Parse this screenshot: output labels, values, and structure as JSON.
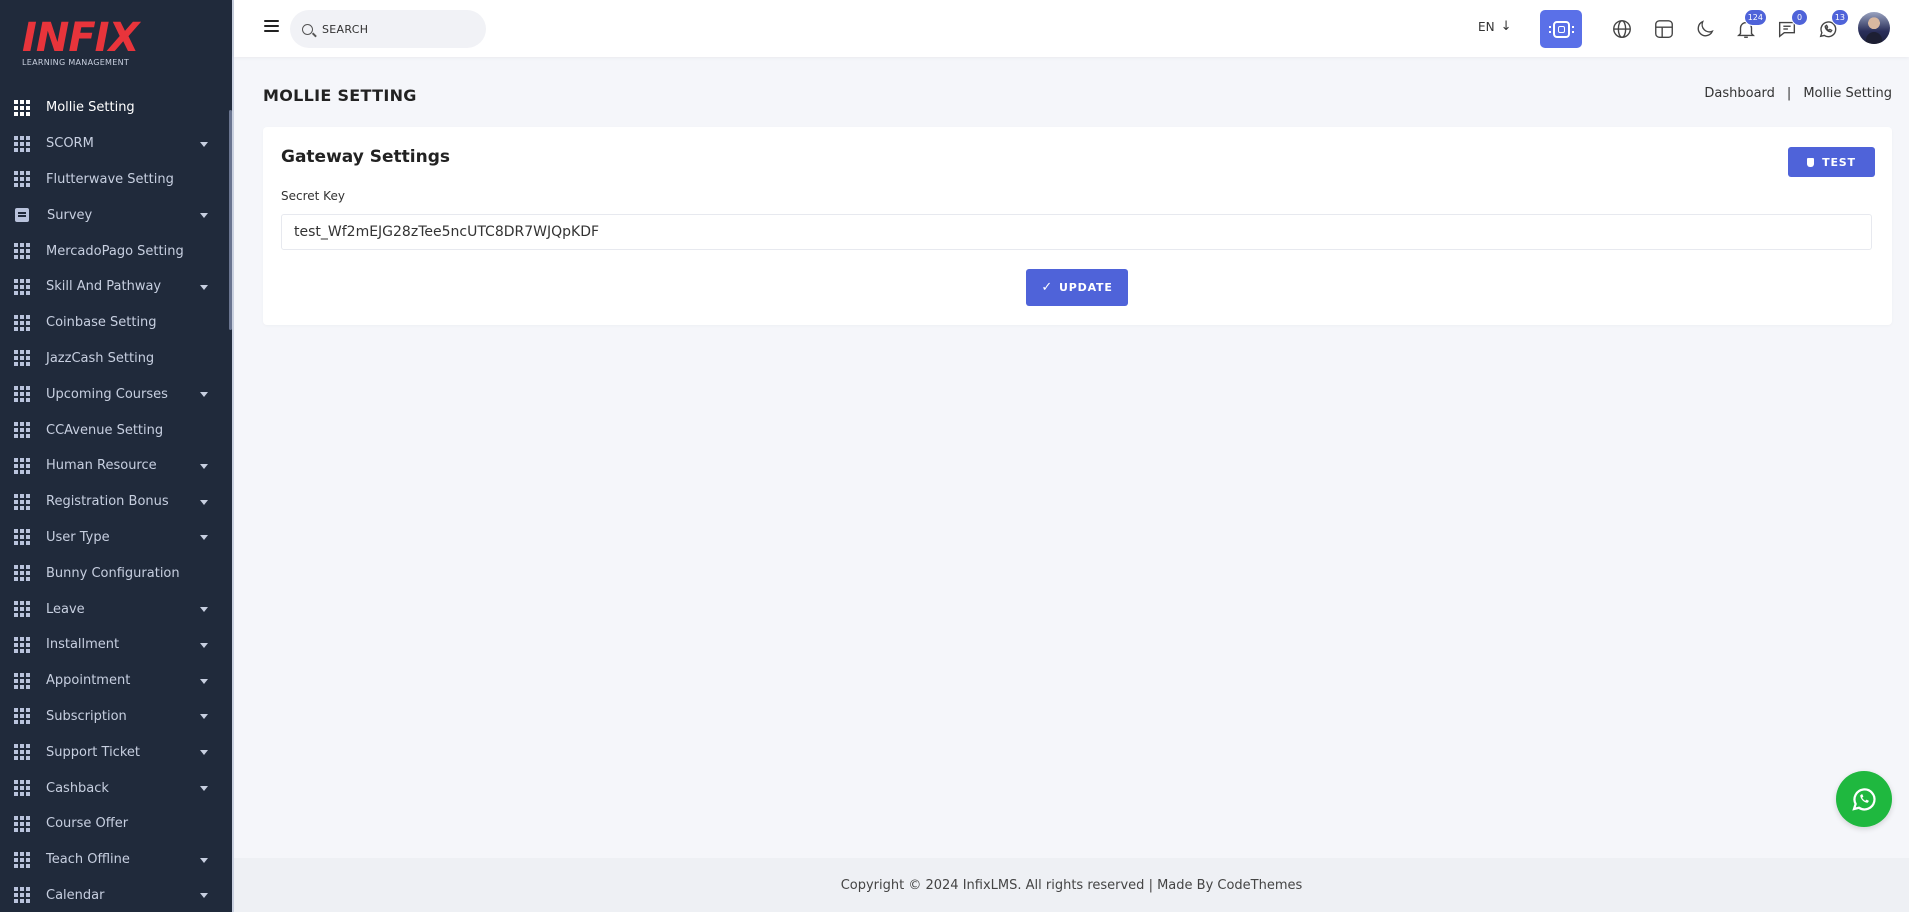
{
  "sidebar": {
    "logo": {
      "brand": "INFIX",
      "tagline": "LEARNING MANAGEMENT"
    },
    "items": [
      {
        "label": "Mollie Setting",
        "icon": "grid-icon",
        "active": true,
        "has_submenu": false
      },
      {
        "label": "SCORM",
        "icon": "grid-icon",
        "has_submenu": true
      },
      {
        "label": "Flutterwave Setting",
        "icon": "grid-icon",
        "has_submenu": false
      },
      {
        "label": "Survey",
        "icon": "document-icon",
        "has_submenu": true
      },
      {
        "label": "MercadoPago Setting",
        "icon": "grid-icon",
        "has_submenu": false
      },
      {
        "label": "Skill And Pathway",
        "icon": "grid-icon",
        "has_submenu": true
      },
      {
        "label": "Coinbase Setting",
        "icon": "grid-icon",
        "has_submenu": false
      },
      {
        "label": "JazzCash Setting",
        "icon": "grid-icon",
        "has_submenu": false
      },
      {
        "label": "Upcoming Courses",
        "icon": "grid-icon",
        "has_submenu": true
      },
      {
        "label": "CCAvenue Setting",
        "icon": "grid-icon",
        "has_submenu": false
      },
      {
        "label": "Human Resource",
        "icon": "grid-icon",
        "has_submenu": true
      },
      {
        "label": "Registration Bonus",
        "icon": "grid-icon",
        "has_submenu": true
      },
      {
        "label": "User Type",
        "icon": "grid-icon",
        "has_submenu": true
      },
      {
        "label": "Bunny Configuration",
        "icon": "grid-icon",
        "has_submenu": false
      },
      {
        "label": "Leave",
        "icon": "grid-icon",
        "has_submenu": true
      },
      {
        "label": "Installment",
        "icon": "grid-icon",
        "has_submenu": true
      },
      {
        "label": "Appointment",
        "icon": "grid-icon",
        "has_submenu": true
      },
      {
        "label": "Subscription",
        "icon": "grid-icon",
        "has_submenu": true
      },
      {
        "label": "Support Ticket",
        "icon": "grid-icon",
        "has_submenu": true
      },
      {
        "label": "Cashback",
        "icon": "grid-icon",
        "has_submenu": true
      },
      {
        "label": "Course Offer",
        "icon": "grid-icon",
        "has_submenu": false
      },
      {
        "label": "Teach Offline",
        "icon": "grid-icon",
        "has_submenu": true
      },
      {
        "label": "Calendar",
        "icon": "grid-icon",
        "has_submenu": true
      }
    ]
  },
  "topbar": {
    "search_placeholder": "SEARCH",
    "language": "EN",
    "language_arrow": "↓",
    "notifications_count": "124",
    "messages_count": "0",
    "whatsapp_count": "13"
  },
  "page": {
    "title": "MOLLIE SETTING",
    "breadcrumb": [
      "Dashboard",
      "Mollie Setting"
    ],
    "breadcrumb_separator": "|"
  },
  "card": {
    "title": "Gateway Settings",
    "test_label": "TEST",
    "secret_key_label": "Secret Key",
    "secret_key_value": "test_Wf2mEJG28zTee5ncUTC8DR7WJQpKDF",
    "update_label": "UPDATE",
    "update_check": "✓"
  },
  "footer": {
    "text": "Copyright © 2024 InfixLMS. All rights reserved | Made By CodeThemes"
  },
  "colors": {
    "sidebar_bg": "#202a3b",
    "accent": "#4f63d9",
    "brand_red": "#e8343b",
    "whatsapp_green": "#1fb83f"
  }
}
